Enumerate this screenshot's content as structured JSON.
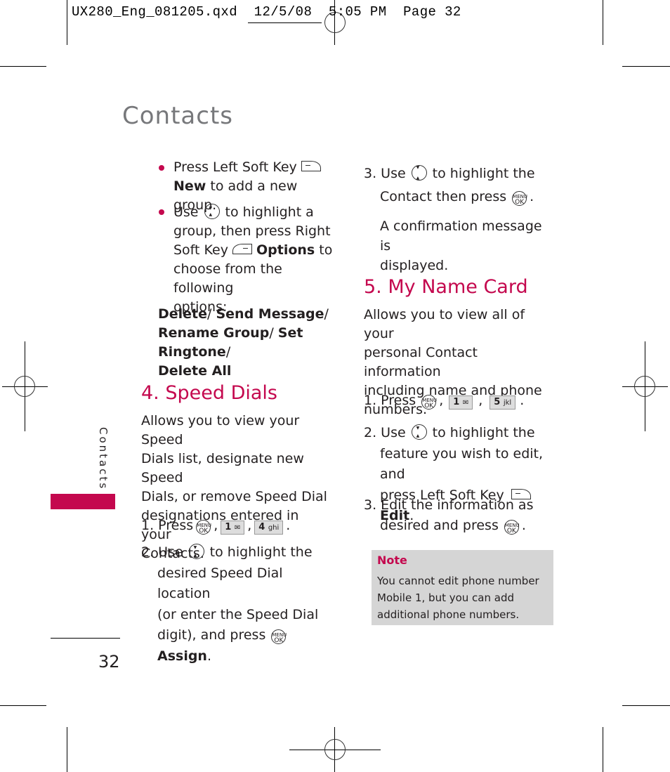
{
  "slug": {
    "filename": "UX280_Eng_081205.qxd",
    "date": "12/5/08",
    "time": "5:05 PM",
    "page_label": "Page 32"
  },
  "page": {
    "title": "Contacts",
    "side_tab": "Contacts",
    "page_number": "32",
    "accent_color": "#c4084e"
  },
  "left_column": {
    "bullets": [
      {
        "line1_pre": "Press Left Soft Key",
        "line2_bold": "New",
        "line2_rest": " to add a new group."
      },
      {
        "line1_pre": "Use",
        "line1_post": "to highlight a",
        "line2": "group, then press Right",
        "line3_pre": "Soft Key",
        "line3_bold": "Options",
        "line3_post": " to",
        "line4": "choose from the following",
        "line5": "options:"
      }
    ],
    "options_list": {
      "line1": [
        "Delete",
        "/ ",
        "Send Message",
        "/"
      ],
      "line2": [
        "Rename Group",
        "/ ",
        "Set Ringtone",
        "/"
      ],
      "line3": "Delete All"
    },
    "speed_dials": {
      "heading": "4. Speed Dials",
      "intro": [
        "Allows you to view your Speed",
        "Dials list, designate new Speed",
        "Dials, or remove Speed Dial",
        "designations entered in your",
        "Contacts."
      ],
      "step1": {
        "pre": "1. Press",
        "key1_digit": "1",
        "key2_digit": "4",
        "key2_letters": "ghi"
      },
      "step2": {
        "line1_pre": "2. Use",
        "line1_post": "to highlight the",
        "line2": "desired Speed Dial location",
        "line3": "(or enter the Speed Dial",
        "line4_pre": "digit), and press",
        "line4_bold": "Assign"
      }
    }
  },
  "right_column": {
    "step3": {
      "line1_pre": "3. Use",
      "line1_post": "to highlight the",
      "line2_pre": "Contact then press",
      "confirmation": [
        "A confirmation message is",
        "displayed."
      ]
    },
    "my_name_card": {
      "heading": "5. My Name Card",
      "intro": [
        "Allows you to view all of your",
        "personal Contact information",
        "including name and phone",
        "numbers."
      ],
      "step1": {
        "pre": "1. Press",
        "key1_digit": "1",
        "key2_digit": "5",
        "key2_letters": "jkl"
      },
      "step2": {
        "line1_pre": "2. Use",
        "line1_post": "to highlight the",
        "line2": "feature you wish to edit, and",
        "line3_pre": "press Left Soft Key",
        "line3_bold": "Edit"
      },
      "step3": {
        "line1": "3. Edit the information as",
        "line2_pre": "desired and press"
      }
    },
    "note": {
      "title": "Note",
      "lines": [
        "You cannot edit phone number",
        "Mobile 1, but you can add",
        "additional phone numbers."
      ]
    }
  },
  "icons": {
    "ok_top": "MENU",
    "ok_bottom": "OK"
  }
}
